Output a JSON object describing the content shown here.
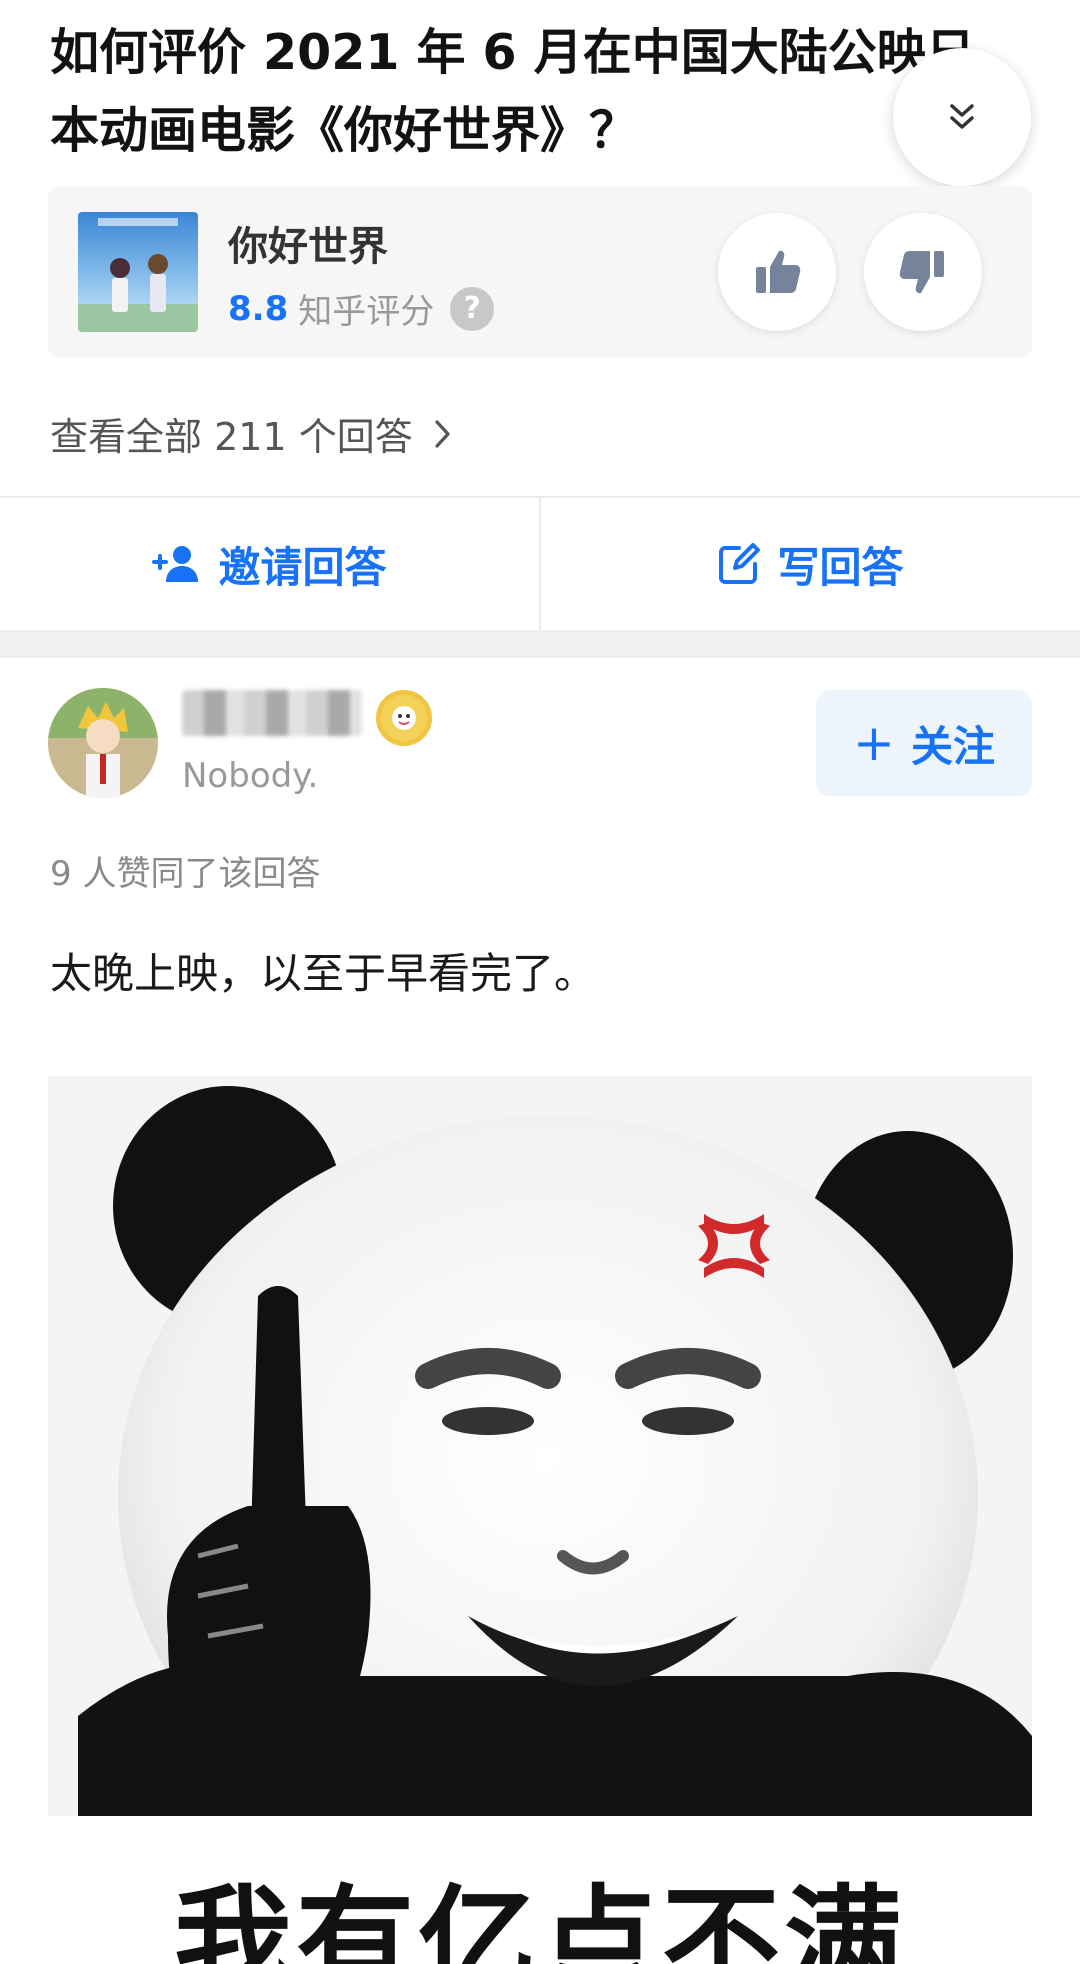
{
  "question": {
    "title": "如何评价 2021 年 6 月在中国大陆公映日本动画电影《你好世界》？"
  },
  "icons": {
    "collapse": "double-chevron-down-icon",
    "like": "thumbs-up-icon",
    "dislike": "thumbs-down-icon",
    "help": "question-mark-icon",
    "invite": "add-person-icon",
    "write": "edit-icon",
    "chevron": "chevron-right-icon"
  },
  "movie": {
    "name": "你好世界",
    "score": "8.8",
    "score_label": "知乎评分",
    "help_glyph": "?"
  },
  "answers_link": {
    "label": "查看全部 211 个回答"
  },
  "actions": {
    "invite_label": "邀请回答",
    "write_label": "写回答"
  },
  "answer": {
    "author_bio": "Nobody.",
    "follow_label": "关注",
    "follow_plus": "+",
    "upvote_text": "9 人赞同了该回答",
    "content": "太晚上映，以至于早看完了。",
    "meme_caption": "我有亿点不满"
  },
  "colors": {
    "accent": "#1772f6",
    "card_bg": "#f6f6f6",
    "follow_bg": "#eef4fb"
  }
}
